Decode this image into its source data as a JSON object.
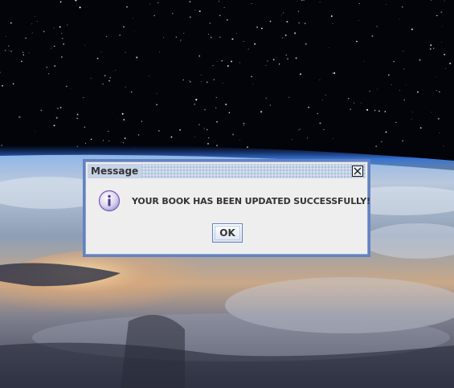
{
  "dialog": {
    "title": "Message",
    "message": "YOUR BOOK HAS BEEN UPDATED SUCCESSFULLY!",
    "icon": "info-icon",
    "ok_label": "OK",
    "close_icon": "close-icon"
  },
  "colors": {
    "dialog_border": "#6382bf",
    "dialog_background": "#eeeeee",
    "titlebar": "#c6d3e6",
    "text": "#333333"
  }
}
